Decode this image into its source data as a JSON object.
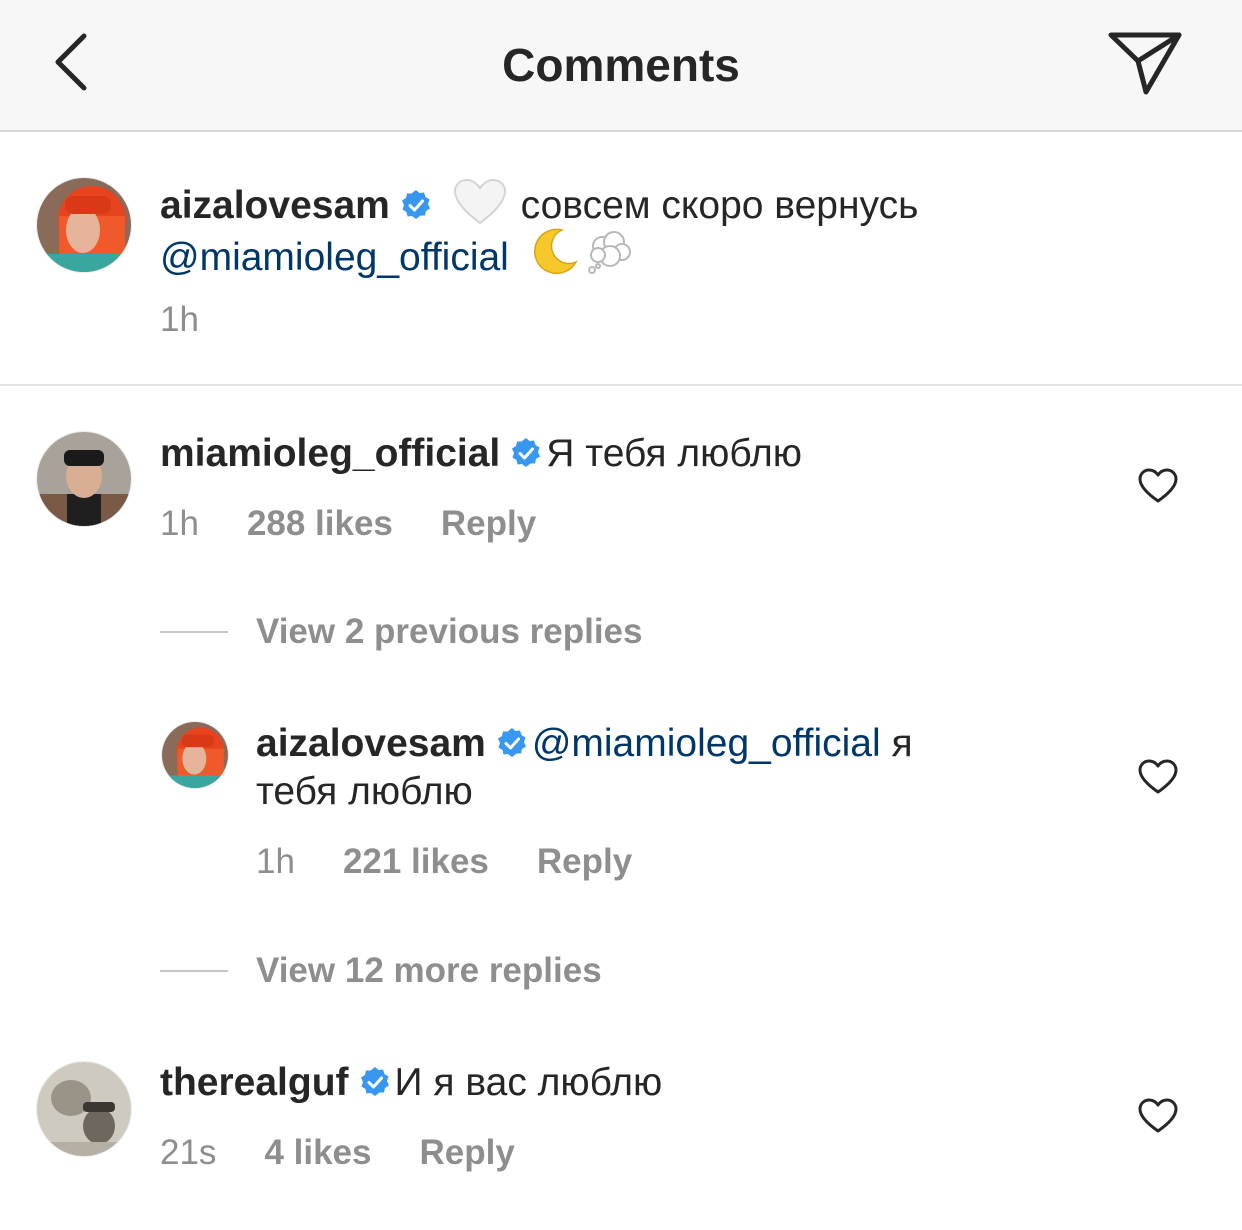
{
  "header": {
    "title": "Comments"
  },
  "caption": {
    "username": "aizalovesam",
    "text": "совсем скоро вернусь",
    "mention": "@miamioleg_official",
    "time": "1h"
  },
  "comments": [
    {
      "username": "miamioleg_official",
      "text": "Я тебя люблю",
      "time": "1h",
      "likes": "288 likes",
      "reply": "Reply",
      "view_replies": "View 2 previous replies"
    },
    {
      "username": "aizalovesam",
      "mention": "@miamioleg_official",
      "text_after_mention": "я",
      "text_line2": "тебя люблю",
      "time": "1h",
      "likes": "221 likes",
      "reply": "Reply",
      "view_replies": "View 12 more replies"
    },
    {
      "username": "therealguf",
      "text": "И я вас люблю",
      "time": "21s",
      "likes": "4 likes",
      "reply": "Reply"
    }
  ],
  "icons": {
    "back": "chevron-left-icon",
    "send": "paper-plane-icon",
    "verified": "verified-badge-icon",
    "like": "heart-outline-icon",
    "white_heart": "white-heart-emoji",
    "moon": "crescent-moon-emoji",
    "thought": "thought-balloon-emoji"
  },
  "colors": {
    "text": "#262626",
    "secondary": "#8e8e8e",
    "mention": "#00376b",
    "verified": "#3897f0",
    "header_bg": "#f7f7f7"
  }
}
